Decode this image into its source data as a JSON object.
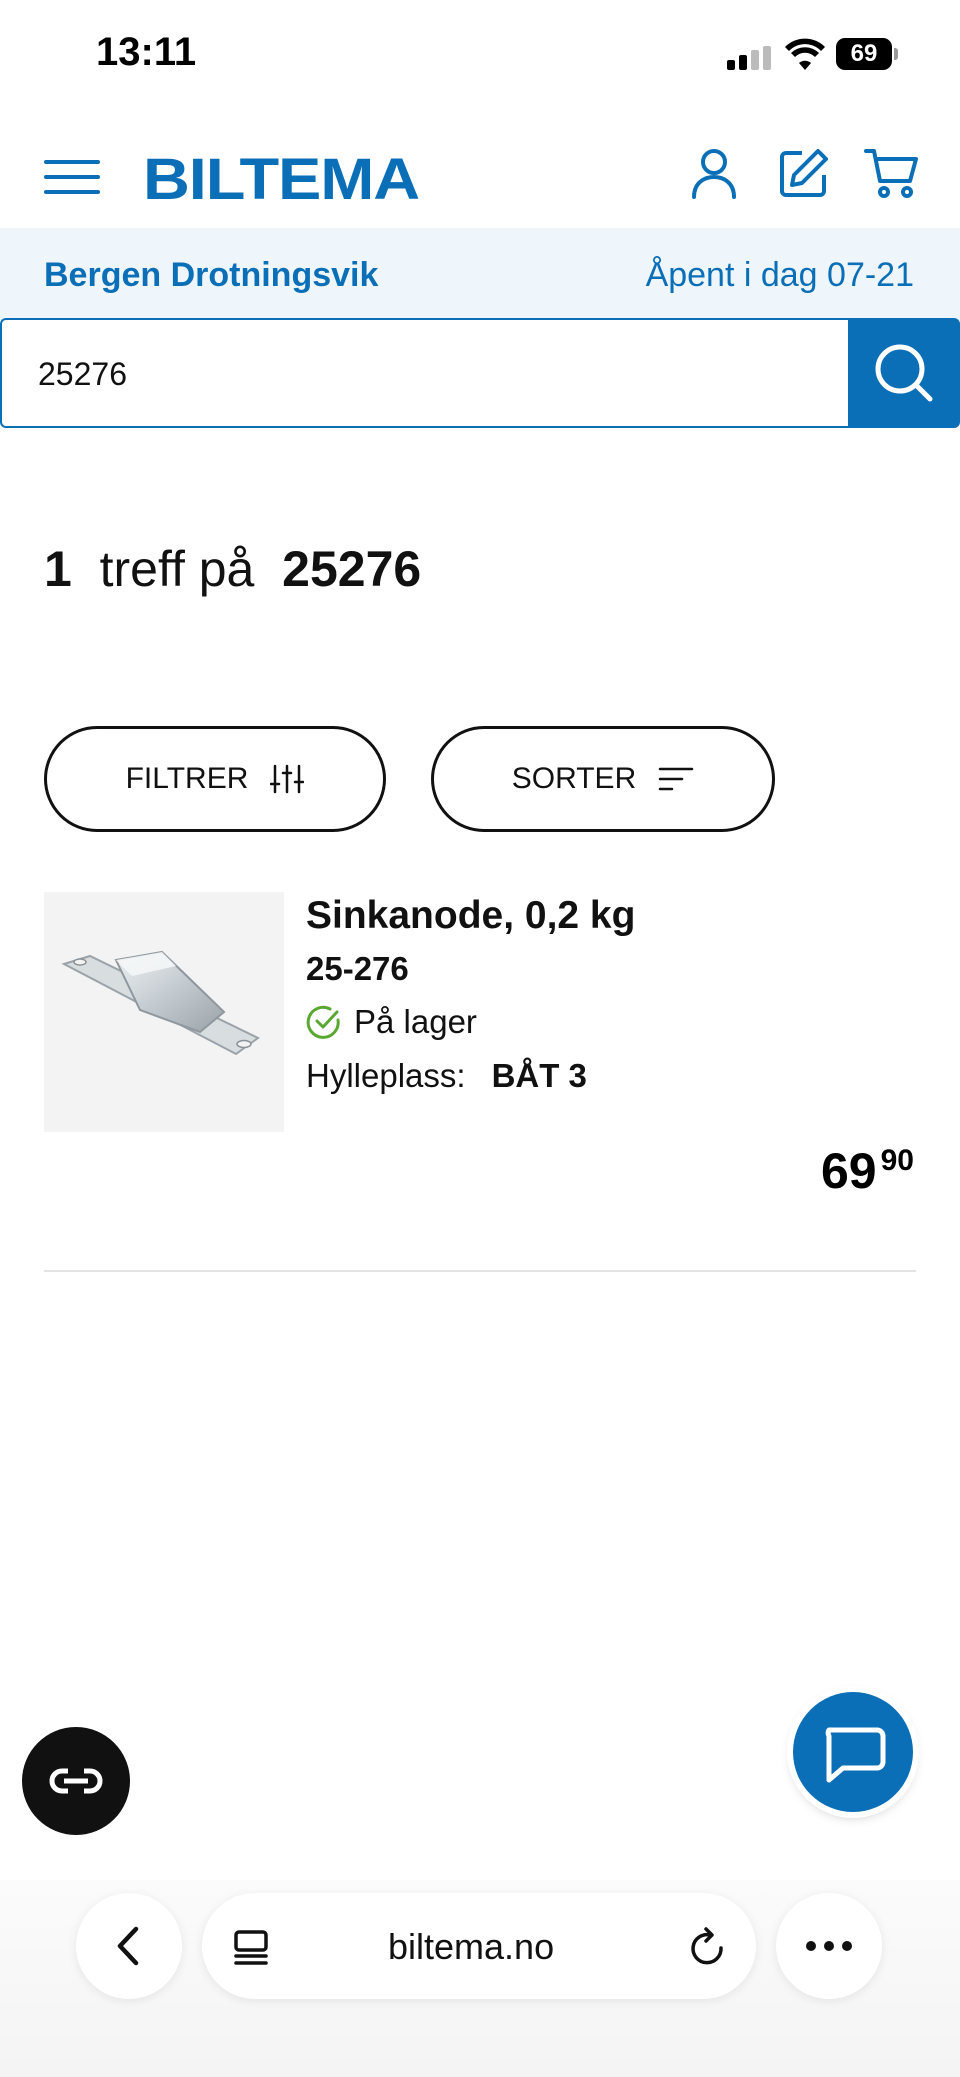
{
  "status_bar": {
    "time": "13:11",
    "battery": "69"
  },
  "header": {
    "logo": "BILTEMA",
    "icons": [
      "menu-icon",
      "account-icon",
      "edit-icon",
      "cart-icon"
    ],
    "brand_color": "#0b6fb8"
  },
  "store": {
    "name": "Bergen Drotningsvik",
    "hours": "Åpent i dag 07-21"
  },
  "search": {
    "value": "25276"
  },
  "results": {
    "count": "1",
    "text": "treff på",
    "query": "25276"
  },
  "controls": {
    "filter_label": "FILTRER",
    "sort_label": "SORTER"
  },
  "product": {
    "title": "Sinkanode, 0,2 kg",
    "sku": "25-276",
    "stock": "På lager",
    "shelf_label": "Hylleplass:",
    "shelf_value": "BÅT 3",
    "price_whole": "69",
    "price_cents": "90",
    "stock_color": "#5aa832"
  },
  "browser": {
    "url": "biltema.no"
  }
}
